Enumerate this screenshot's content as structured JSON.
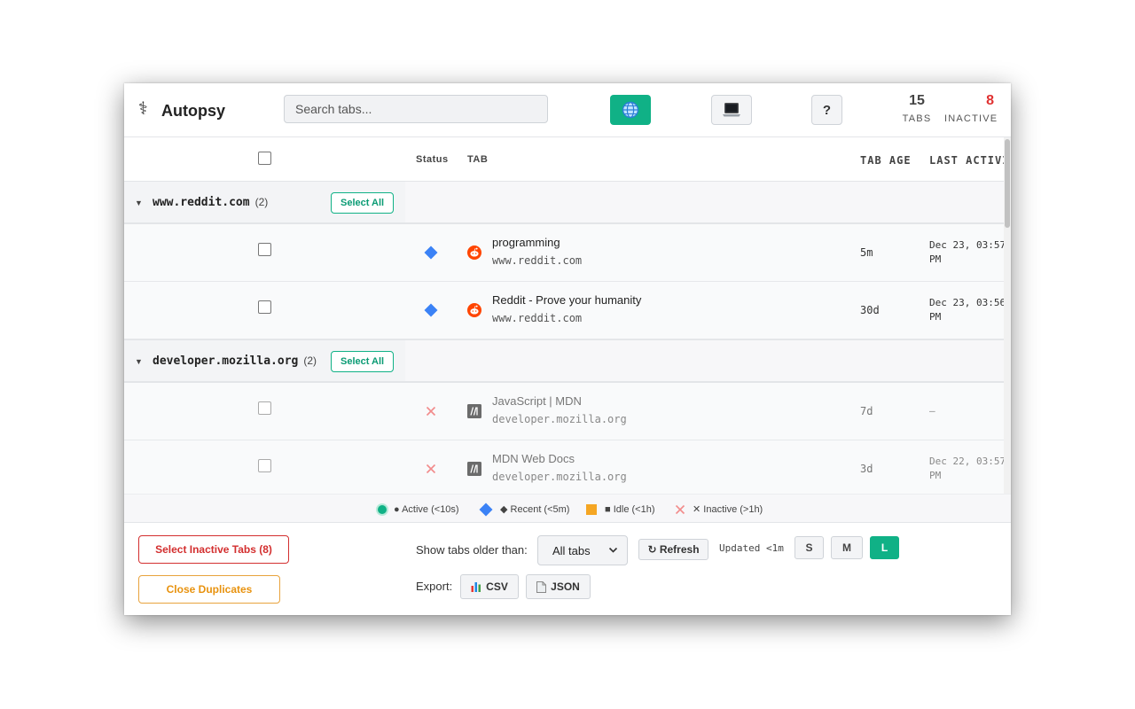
{
  "app": {
    "title": "Autopsy",
    "logo_glyph": "⚕"
  },
  "search": {
    "placeholder": "Search tabs..."
  },
  "header": {
    "help_label": "?",
    "stats": {
      "tabs_count": "15",
      "tabs_label": "TABS",
      "inactive_count": "8",
      "inactive_label": "INACTIVE"
    }
  },
  "columns": {
    "status": "Status",
    "tab": "TAB",
    "tab_age": "TAB AGE",
    "last_activity": "LAST ACTIVIT"
  },
  "groups": [
    {
      "name": "www.reddit.com",
      "count": "(2)",
      "select_all": "Select All",
      "rows": [
        {
          "status": "recent",
          "favicon": "reddit-icon",
          "title": "programming",
          "domain": "www.reddit.com",
          "age": "5m",
          "last_line1": "Dec 23, 03:57",
          "last_line2": "PM"
        },
        {
          "status": "recent",
          "favicon": "reddit-icon",
          "title": "Reddit - Prove your humanity",
          "domain": "www.reddit.com",
          "age": "30d",
          "last_line1": "Dec 23, 03:56",
          "last_line2": "PM"
        }
      ]
    },
    {
      "name": "developer.mozilla.org",
      "count": "(2)",
      "select_all": "Select All",
      "rows": [
        {
          "status": "inactive",
          "favicon": "mdn-icon",
          "title": "JavaScript | MDN",
          "domain": "developer.mozilla.org",
          "age": "7d",
          "last_line1": "—",
          "last_line2": ""
        },
        {
          "status": "inactive",
          "favicon": "mdn-icon",
          "title": "MDN Web Docs",
          "domain": "developer.mozilla.org",
          "age": "3d",
          "last_line1": "Dec 22, 03:57",
          "last_line2": "PM"
        }
      ]
    }
  ],
  "legend": {
    "active": "● Active (<10s)",
    "recent": "◆ Recent (<5m)",
    "idle": "■ Idle (<1h)",
    "inactive": "✕ Inactive (>1h)"
  },
  "footer": {
    "select_inactive": "Select Inactive Tabs (8)",
    "close_duplicates": "Close Duplicates",
    "show_older_label": "Show tabs older than:",
    "older_selected": "All tabs",
    "refresh": "↻ Refresh",
    "updated": "Updated <1m",
    "sizes": [
      "S",
      "M",
      "L"
    ],
    "active_size": "L",
    "export_label": "Export:",
    "export_csv": "CSV",
    "export_json": "JSON"
  },
  "colors": {
    "accent": "#10b186",
    "danger": "#d32f2f",
    "warning": "#e8920e",
    "recent": "#3b82f6",
    "idle": "#f5a623",
    "inactive": "#f28b8b"
  }
}
